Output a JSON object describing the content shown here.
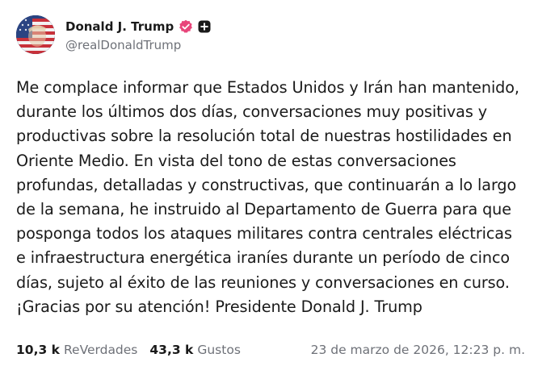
{
  "post": {
    "author": {
      "display_name": "Donald J. Trump",
      "handle": "@realDonaldTrump",
      "verified_icon": "verified-badge-icon",
      "extra_icon": "plus-icon",
      "verified_color": "#e8457a"
    },
    "text": "Me complace informar que Estados Unidos y Irán han mantenido,\ndurante los últimos dos días, conversaciones muy positivas y\nproductivas sobre la resolución total de nuestras hostilidades en\nOriente Medio. En vista del tono de estas conversaciones\nprofundas, detalladas y constructivas, que continuarán a lo largo\nde la semana, he instruido al Departamento de Guerra para que\nposponga todos los ataques militares contra centrales eléctricas\ne infraestructura energética iraníes durante un período de cinco\ndías, sujeto al éxito de las reuniones y conversaciones en curso.\n¡Gracias por su atención! Presidente Donald J. Trump",
    "stats": {
      "reposts_count": "10,3 k",
      "reposts_label": "ReVerdades",
      "likes_count": "43,3 k",
      "likes_label": "Gustos"
    },
    "timestamp": "23 de marzo de 2026, 12:23 p. m."
  }
}
